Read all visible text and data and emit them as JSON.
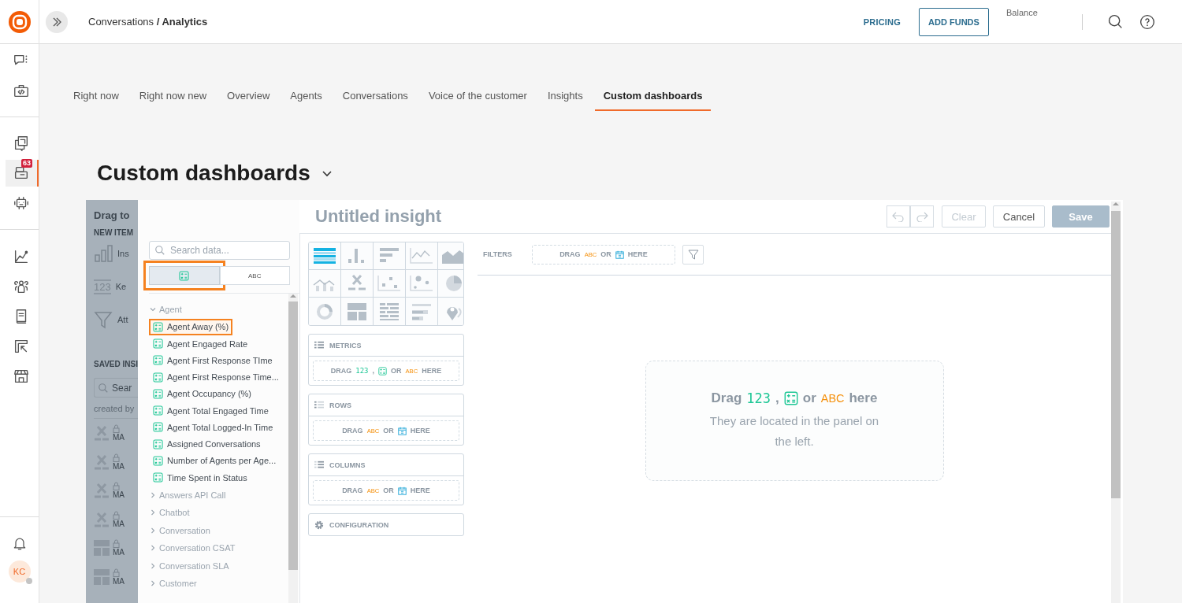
{
  "rail": {
    "groups": [
      [
        {
          "kind": "chat",
          "selected": false
        },
        {
          "kind": "code",
          "selected": false
        }
      ],
      [
        {
          "kind": "copy",
          "selected": false
        },
        {
          "kind": "inbox",
          "selected": true,
          "badge": "63"
        },
        {
          "kind": "bot",
          "selected": false
        }
      ],
      [
        {
          "kind": "chart",
          "selected": false
        },
        {
          "kind": "people",
          "selected": false
        },
        {
          "kind": "book",
          "selected": false
        },
        {
          "kind": "pointer",
          "selected": false
        },
        {
          "kind": "store",
          "selected": false
        }
      ]
    ],
    "user": {
      "initials": "KC",
      "online": false
    }
  },
  "topbar": {
    "breadcrumb": "Conversations **/ Analytics**",
    "pricing": "PRICING",
    "add_funds": "ADD FUNDS",
    "balance_label": "Balance"
  },
  "tabs": [
    {
      "label": "Right now",
      "selected": false
    },
    {
      "label": "Right now new",
      "selected": false
    },
    {
      "label": "Overview",
      "selected": false
    },
    {
      "label": "Agents",
      "selected": false
    },
    {
      "label": "Conversations",
      "selected": false
    },
    {
      "label": "Voice of the customer",
      "selected": false
    },
    {
      "label": "Insights",
      "selected": false
    },
    {
      "label": "Custom dashboards",
      "selected": true
    }
  ],
  "page_title": "Custom dashboards",
  "side_panel": {
    "title": "Drag to",
    "new_item_heading": "NEW ITEM",
    "new_items": [
      {
        "kind": "insight",
        "label": "Ins"
      },
      {
        "kind": "kpi",
        "symbol": "123",
        "label": "Ke"
      },
      {
        "kind": "filter",
        "label": "Att"
      }
    ],
    "saved_heading": "SAVED INSI",
    "search_placeholder": "Sear",
    "owner_filter": "created by",
    "saved_items": [
      {
        "kind": "headline",
        "locked": true,
        "label": "MA"
      },
      {
        "kind": "headline",
        "locked": true,
        "label": "MA"
      },
      {
        "kind": "headline",
        "locked": true,
        "label": "MA"
      },
      {
        "kind": "headline",
        "locked": true,
        "label": "MA"
      },
      {
        "kind": "treemap",
        "locked": true,
        "label": "MA"
      },
      {
        "kind": "treemap",
        "locked": true,
        "label": "MA"
      }
    ]
  },
  "data_panel": {
    "search_placeholder": "Search data...",
    "type_toggle": [
      {
        "kind": "metric",
        "selected": true,
        "highlighted": true
      },
      {
        "kind": "attribute",
        "label": "ABC",
        "selected": false,
        "highlighted": false
      }
    ],
    "tree": [
      {
        "label": "Agent",
        "expanded": true,
        "children": [
          {
            "label": "Agent Away (%)",
            "highlighted": true
          },
          {
            "label": "Agent Engaged Rate",
            "highlighted": false
          },
          {
            "label": "Agent First Response TIme",
            "highlighted": false
          },
          {
            "label": "Agent First Response Time...",
            "highlighted": false
          },
          {
            "label": "Agent Occupancy (%)",
            "highlighted": false
          },
          {
            "label": "Agent Total Engaged Time",
            "highlighted": false
          },
          {
            "label": "Agent Total Logged-In Time",
            "highlighted": false
          },
          {
            "label": "Assigned Conversations",
            "highlighted": false
          },
          {
            "label": "Number of Agents per Age...",
            "highlighted": false
          },
          {
            "label": "Time Spent in Status",
            "highlighted": false
          }
        ]
      },
      {
        "label": "Answers API Call",
        "expanded": false
      },
      {
        "label": "Chatbot",
        "expanded": false
      },
      {
        "label": "Conversation",
        "expanded": false
      },
      {
        "label": "Conversation CSAT",
        "expanded": false
      },
      {
        "label": "Conversation SLA",
        "expanded": false
      },
      {
        "label": "Customer",
        "expanded": false
      }
    ]
  },
  "insight": {
    "title": "Untitled insight",
    "toolbar": [
      {
        "kind": "undo",
        "disabled": true
      },
      {
        "kind": "redo",
        "disabled": true
      },
      {
        "kind": "secondary",
        "label": "Clear",
        "disabled": true
      },
      {
        "kind": "secondary",
        "label": "Cancel",
        "disabled": false
      },
      {
        "kind": "primary",
        "label": "Save",
        "disabled": true
      }
    ],
    "chart_types": [
      {
        "kind": "table",
        "selected": true
      },
      {
        "kind": "column",
        "selected": false
      },
      {
        "kind": "bar",
        "selected": false
      },
      {
        "kind": "line",
        "selected": false
      },
      {
        "kind": "area",
        "selected": false
      },
      {
        "kind": "combo",
        "selected": false
      },
      {
        "kind": "headline",
        "selected": false
      },
      {
        "kind": "scatter",
        "selected": false
      },
      {
        "kind": "bubble",
        "selected": false
      },
      {
        "kind": "pie",
        "selected": false
      },
      {
        "kind": "donut",
        "selected": false
      },
      {
        "kind": "treemap",
        "selected": false
      },
      {
        "kind": "heatmap",
        "selected": false
      },
      {
        "kind": "bullet",
        "selected": false
      },
      {
        "kind": "geo",
        "selected": false
      }
    ],
    "buckets": [
      {
        "kind": "metrics",
        "title": "METRICS",
        "drop": [
          {
            "kind": "text",
            "text": "DRAG"
          },
          {
            "kind": "number",
            "text": "123"
          },
          {
            "kind": "text",
            "text": ","
          },
          {
            "kind": "metric"
          },
          {
            "kind": "text",
            "text": "OR"
          },
          {
            "kind": "attribute",
            "text": "ABC"
          },
          {
            "kind": "text",
            "text": "HERE"
          }
        ]
      },
      {
        "kind": "rows",
        "title": "ROWS",
        "drop": [
          {
            "kind": "text",
            "text": "DRAG"
          },
          {
            "kind": "attribute",
            "text": "ABC"
          },
          {
            "kind": "text",
            "text": "OR"
          },
          {
            "kind": "date"
          },
          {
            "kind": "text",
            "text": "HERE"
          }
        ]
      },
      {
        "kind": "columns",
        "title": "COLUMNS",
        "drop": [
          {
            "kind": "text",
            "text": "DRAG"
          },
          {
            "kind": "attribute",
            "text": "ABC"
          },
          {
            "kind": "text",
            "text": "OR"
          },
          {
            "kind": "date"
          },
          {
            "kind": "text",
            "text": "HERE"
          }
        ]
      },
      {
        "kind": "configuration",
        "title": "CONFIGURATION"
      }
    ],
    "filters": {
      "label": "FILTERS",
      "drop": [
        {
          "kind": "text",
          "text": "DRAG"
        },
        {
          "kind": "attribute",
          "text": "ABC"
        },
        {
          "kind": "text",
          "text": "OR"
        },
        {
          "kind": "date"
        },
        {
          "kind": "text",
          "text": "HERE"
        }
      ]
    },
    "empty_state": {
      "title": [
        {
          "kind": "text",
          "text": "Drag"
        },
        {
          "kind": "number",
          "text": "123"
        },
        {
          "kind": "text",
          "text": ","
        },
        {
          "kind": "metric"
        },
        {
          "kind": "text",
          "text": "or"
        },
        {
          "kind": "attribute",
          "text": "ABC"
        },
        {
          "kind": "text",
          "text": "here"
        }
      ],
      "description": "They are located in the panel on the left."
    }
  }
}
